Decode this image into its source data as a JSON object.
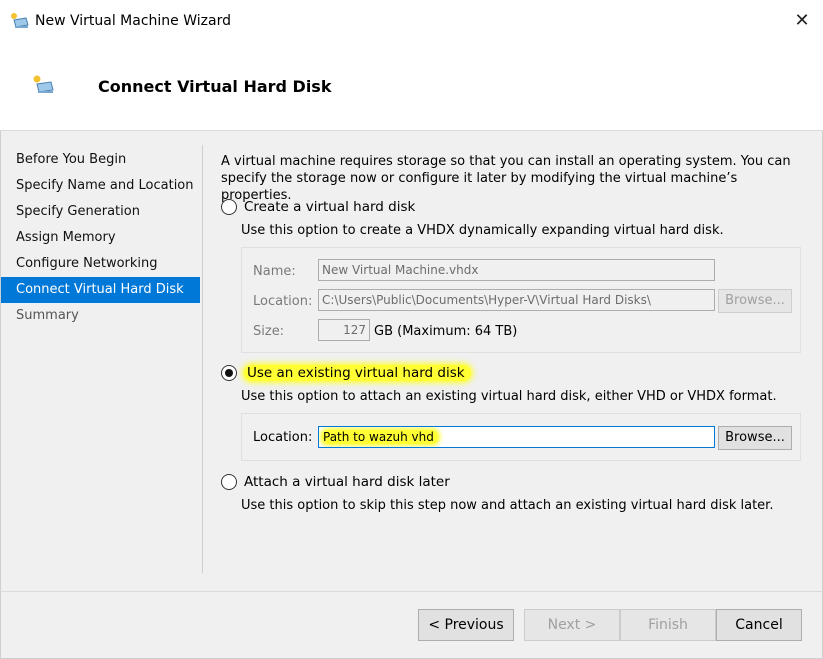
{
  "window": {
    "title": "New Virtual Machine Wizard",
    "close_glyph": "✕"
  },
  "header": {
    "title": "Connect Virtual Hard Disk",
    "icon": "monitor-wizard-icon"
  },
  "nav": {
    "items": [
      {
        "label": "Before You Begin",
        "state": "normal"
      },
      {
        "label": "Specify Name and Location",
        "state": "normal"
      },
      {
        "label": "Specify Generation",
        "state": "normal"
      },
      {
        "label": "Assign Memory",
        "state": "normal"
      },
      {
        "label": "Configure Networking",
        "state": "normal"
      },
      {
        "label": "Connect Virtual Hard Disk",
        "state": "active"
      },
      {
        "label": "Summary",
        "state": "disabled"
      }
    ]
  },
  "main": {
    "intro": "A virtual machine requires storage so that you can install an operating system. You can specify the storage now or configure it later by modifying the virtual machine’s properties.",
    "option_create": {
      "label": "Create a virtual hard disk",
      "checked": false,
      "description": "Use this option to create a VHDX dynamically expanding virtual hard disk.",
      "name_label": "Name:",
      "name_value": "New Virtual Machine.vhdx",
      "location_label": "Location:",
      "location_value": "C:\\Users\\Public\\Documents\\Hyper-V\\Virtual Hard Disks\\",
      "browse_label": "Browse...",
      "size_label": "Size:",
      "size_value": "127",
      "size_unit": "GB (Maximum: 64 TB)"
    },
    "option_existing": {
      "label": "Use an existing virtual hard disk",
      "checked": true,
      "description": "Use this option to attach an existing virtual hard disk, either VHD or VHDX format.",
      "location_label": "Location:",
      "location_value": "Path to wazuh vhd",
      "browse_label": "Browse..."
    },
    "option_later": {
      "label": "Attach a virtual hard disk later",
      "checked": false,
      "description": "Use this option to skip this step now and attach an existing virtual hard disk later."
    }
  },
  "footer": {
    "previous_label": "< Previous",
    "next_label": "Next >",
    "finish_label": "Finish",
    "cancel_label": "Cancel"
  },
  "colors": {
    "accent": "#0078d7",
    "highlight": "#ffff33"
  }
}
